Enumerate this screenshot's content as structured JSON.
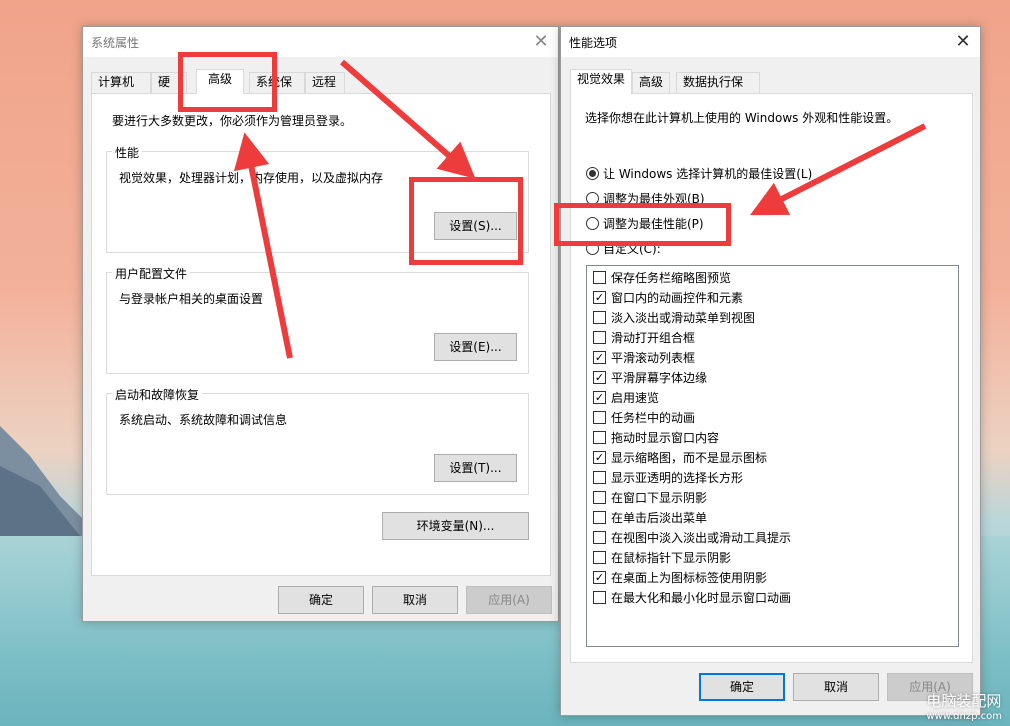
{
  "system_properties": {
    "title": "系统属性",
    "tabs": [
      "计算机名",
      "硬件",
      "高级",
      "系统保护",
      "远程"
    ],
    "admin_note": "要进行大多数更改，你必须作为管理员登录。",
    "performance": {
      "legend": "性能",
      "description": "视觉效果，处理器计划，内存使用，以及虚拟内存",
      "button": "设置(S)..."
    },
    "user_profiles": {
      "legend": "用户配置文件",
      "description": "与登录帐户相关的桌面设置",
      "button": "设置(E)..."
    },
    "startup_recovery": {
      "legend": "启动和故障恢复",
      "description": "系统启动、系统故障和调试信息",
      "button": "设置(T)..."
    },
    "env_button": "环境变量(N)...",
    "ok": "确定",
    "cancel": "取消",
    "apply": "应用(A)"
  },
  "performance_options": {
    "title": "性能选项",
    "tabs": [
      "视觉效果",
      "高级",
      "数据执行保护"
    ],
    "intro": "选择你想在此计算机上使用的 Windows 外观和性能设置。",
    "radios": [
      {
        "label": "让 Windows 选择计算机的最佳设置(L)",
        "checked": true
      },
      {
        "label": "调整为最佳外观(B)",
        "checked": false
      },
      {
        "label": "调整为最佳性能(P)",
        "checked": false
      },
      {
        "label": "自定义(C):",
        "checked": false
      }
    ],
    "effects": [
      {
        "label": "保存任务栏缩略图预览",
        "checked": false
      },
      {
        "label": "窗口内的动画控件和元素",
        "checked": true
      },
      {
        "label": "淡入淡出或滑动菜单到视图",
        "checked": false
      },
      {
        "label": "滑动打开组合框",
        "checked": false
      },
      {
        "label": "平滑滚动列表框",
        "checked": true
      },
      {
        "label": "平滑屏幕字体边缘",
        "checked": true
      },
      {
        "label": "启用速览",
        "checked": true
      },
      {
        "label": "任务栏中的动画",
        "checked": false
      },
      {
        "label": "拖动时显示窗口内容",
        "checked": false
      },
      {
        "label": "显示缩略图，而不是显示图标",
        "checked": true
      },
      {
        "label": "显示亚透明的选择长方形",
        "checked": false
      },
      {
        "label": "在窗口下显示阴影",
        "checked": false
      },
      {
        "label": "在单击后淡出菜单",
        "checked": false
      },
      {
        "label": "在视图中淡入淡出或滑动工具提示",
        "checked": false
      },
      {
        "label": "在鼠标指针下显示阴影",
        "checked": false
      },
      {
        "label": "在桌面上为图标标签使用阴影",
        "checked": true
      },
      {
        "label": "在最大化和最小化时显示窗口动画",
        "checked": false
      }
    ],
    "ok": "确定",
    "cancel": "取消",
    "apply": "应用(A)"
  },
  "watermark": {
    "name": "电脑装配网",
    "url": "www.dnzp.com"
  },
  "colors": {
    "annotation": "#ee3c3c",
    "focus": "#0078d7"
  },
  "icons": {
    "close": "close-icon",
    "check": "check-icon"
  }
}
